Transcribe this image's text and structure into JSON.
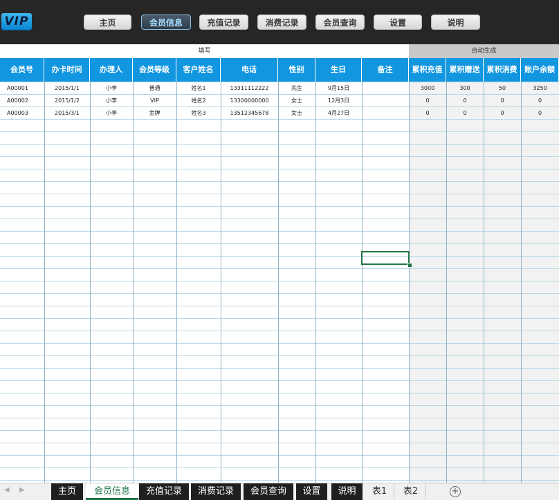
{
  "logo": {
    "text": "VIP"
  },
  "nav": {
    "buttons": [
      {
        "label": "主页",
        "active": false
      },
      {
        "label": "会员信息",
        "active": true
      },
      {
        "label": "充值记录",
        "active": false
      },
      {
        "label": "消费记录",
        "active": false
      },
      {
        "label": "会员查询",
        "active": false
      },
      {
        "label": "设置",
        "active": false
      },
      {
        "label": "说明",
        "active": false
      }
    ]
  },
  "sheet": {
    "groups": {
      "fill": "填写",
      "auto": "自动生成"
    },
    "columns": [
      "会员号",
      "办卡时间",
      "办理人",
      "会员等级",
      "客户姓名",
      "电话",
      "性别",
      "生日",
      "备注",
      "累积充值",
      "累积赠送",
      "累积消费",
      "账户余额"
    ],
    "rows": [
      [
        "A00001",
        "2015/1/1",
        "小李",
        "普通",
        "姓名1",
        "13311112222",
        "先生",
        "9月15日",
        "",
        "3000",
        "300",
        "50",
        "3250"
      ],
      [
        "A00002",
        "2015/1/2",
        "小李",
        "VIP",
        "姓名2",
        "13300000000",
        "女士",
        "12月3日",
        "",
        "0",
        "0",
        "0",
        "0"
      ],
      [
        "A00003",
        "2015/3/1",
        "小李",
        "金牌",
        "姓名3",
        "13512345678",
        "女士",
        "4月27日",
        "",
        "0",
        "0",
        "0",
        "0"
      ]
    ]
  },
  "tabs": {
    "items": [
      {
        "label": "主页",
        "style": "dark"
      },
      {
        "label": "会员信息",
        "style": "sel"
      },
      {
        "label": "充值记录",
        "style": "dark"
      },
      {
        "label": "消费记录",
        "style": "dark"
      },
      {
        "label": "会员查询",
        "style": "dark"
      },
      {
        "label": "设置",
        "style": "dark"
      },
      {
        "label": "说明",
        "style": "dark"
      },
      {
        "label": "表1",
        "style": "plain"
      },
      {
        "label": "表2",
        "style": "plain"
      }
    ],
    "add_icon": "plus-circle-icon"
  },
  "colors": {
    "header_blue": "#1296e0",
    "topbar": "#262626",
    "auto_bg": "#f2f2f2",
    "selection": "#217346"
  }
}
